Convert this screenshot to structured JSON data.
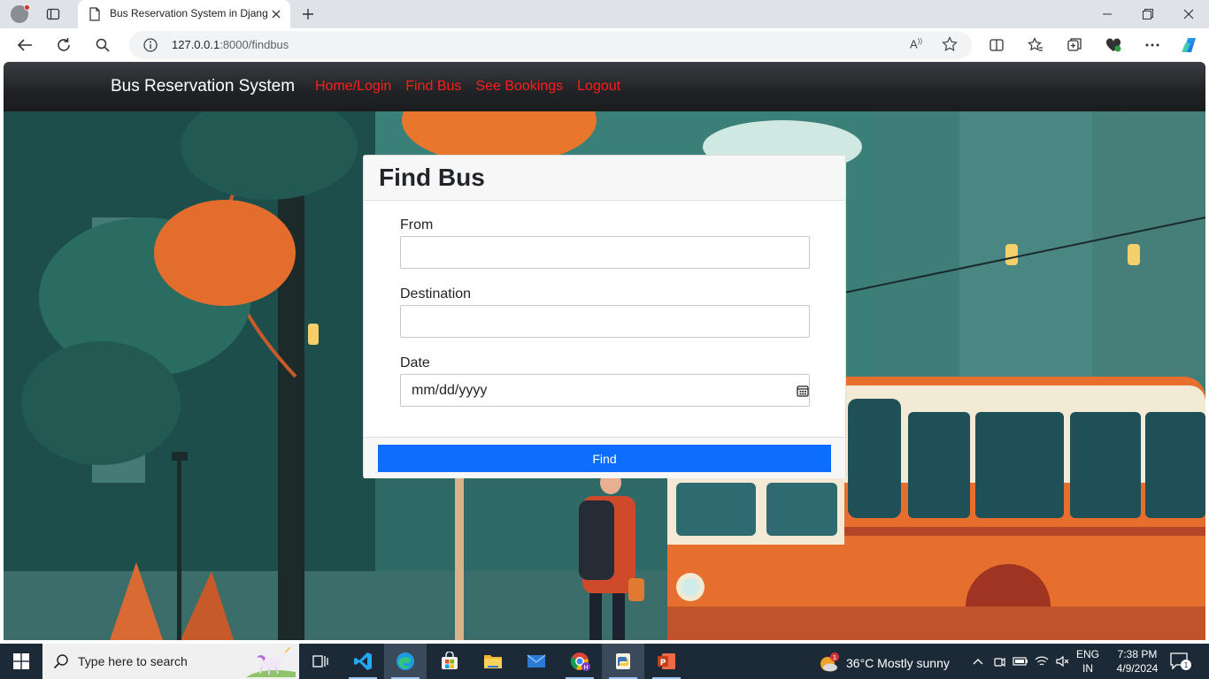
{
  "browser": {
    "tab_title": "Bus Reservation System in Django",
    "url_host": "127.0.0.1",
    "url_rest": ":8000/findbus"
  },
  "navbar": {
    "brand": "Bus Reservation System",
    "links": [
      "Home/Login",
      "Find Bus",
      "See Bookings",
      "Logout"
    ],
    "link_color": "#ff1d1d"
  },
  "form": {
    "heading": "Find Bus",
    "from_label": "From",
    "from_value": "",
    "destination_label": "Destination",
    "destination_value": "",
    "date_label": "Date",
    "date_placeholder": "mm/dd/yyyy",
    "submit_label": "Find",
    "submit_color": "#0d6efd"
  },
  "taskbar": {
    "search_placeholder": "Type here to search",
    "weather": "36°C  Mostly sunny",
    "weather_badge": "1",
    "lang_line1": "ENG",
    "lang_line2": "IN",
    "time": "7:38 PM",
    "date": "4/9/2024",
    "notification_count": "1"
  }
}
